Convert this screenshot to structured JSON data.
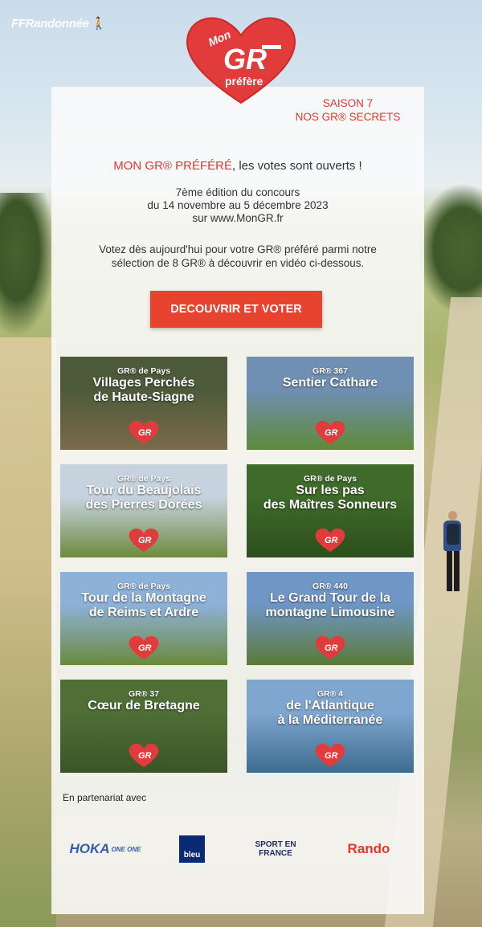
{
  "brand": {
    "ffr_logo": "FFRandonnée",
    "heart_top": "Mon",
    "heart_main": "GR",
    "heart_bottom": "préfère",
    "accent_color": "#e0392a"
  },
  "header": {
    "saison_line1": "SAISON 7",
    "saison_line2": "NOS GR® SECRETS"
  },
  "intro": {
    "headline_red": "MON GR® PRÉFÉRÉ",
    "headline_rest": ", les votes sont ouverts !",
    "edition": "7ème édition du concours",
    "dates": "du 14 novembre au 5 décembre 2023",
    "site": "sur www.MonGR.fr",
    "vote_line1": "Votez dès aujourd'hui pour votre GR® préféré parmi notre",
    "vote_line2": "sélection de 8 GR® à découvrir en vidéo ci-dessous."
  },
  "cta": {
    "label": "DECOUVRIR ET VOTER"
  },
  "tiles": [
    {
      "sub": "GR® de Pays",
      "line1": "Villages Perchés",
      "line2": "de Haute-Siagne",
      "bg": "#4d5a3a",
      "bg2": "#7a6b4a"
    },
    {
      "sub": "GR® 367",
      "line1": "Sentier Cathare",
      "line2": "",
      "bg": "#6f8fb3",
      "bg2": "#5e8a3a"
    },
    {
      "sub": "GR® de Pays",
      "line1": "Tour du Beaujolais",
      "line2": "des Pierres Dorées",
      "bg": "#c6d3df",
      "bg2": "#6e8a3f"
    },
    {
      "sub": "GR® de Pays",
      "line1": "Sur les pas",
      "line2": "des Maîtres Sonneurs",
      "bg": "#3f6a2a",
      "bg2": "#2c4f1c"
    },
    {
      "sub": "GR® de Pays",
      "line1": "Tour de la Montagne",
      "line2": "de Reims et Ardre",
      "bg": "#8eb1d8",
      "bg2": "#6a8a3c"
    },
    {
      "sub": "GR® 440",
      "line1": "Le Grand Tour de la",
      "line2": "montagne Limousine",
      "bg": "#6f96c4",
      "bg2": "#5a7a38"
    },
    {
      "sub": "GR® 37",
      "line1": "Cœur de Bretagne",
      "line2": "",
      "bg": "#4f6f36",
      "bg2": "#3b5527"
    },
    {
      "sub": "GR® 4",
      "line1": "de l'Atlantique",
      "line2": "à la Méditerranée",
      "bg": "#7fa6cf",
      "bg2": "#3d6c8e"
    }
  ],
  "partners": {
    "label": "En partenariat avec",
    "hoka": "HOKA",
    "hoka_small": "ONE ONE",
    "francebleu": "bleu",
    "sport_line1": "SPORT EN",
    "sport_line2": "FRANCE",
    "rando": "Rando"
  }
}
